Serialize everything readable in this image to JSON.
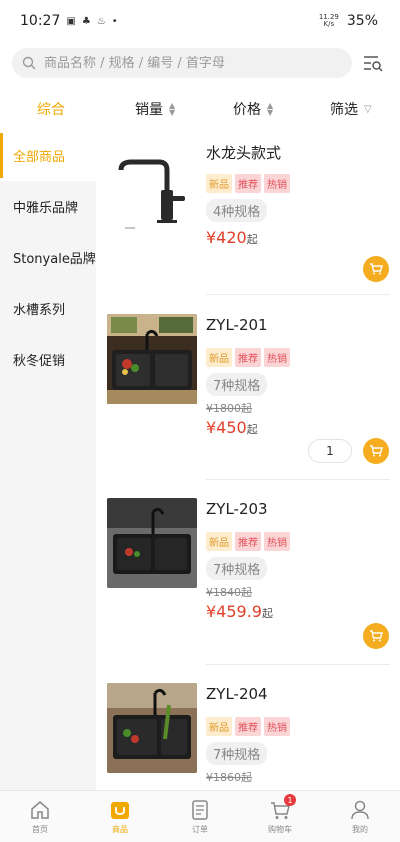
{
  "status_bar": {
    "time": "10:27",
    "net_speed_value": "11.29",
    "net_speed_unit": "K/s",
    "battery": "35%"
  },
  "search": {
    "placeholder": "商品名称 / 规格 / 编号 / 首字母"
  },
  "sort": {
    "comprehensive": "综合",
    "sales": "销量",
    "price": "价格",
    "filter": "筛选"
  },
  "categories": [
    {
      "label": "全部商品",
      "active": true
    },
    {
      "label": "中雅乐品牌",
      "active": false
    },
    {
      "label": "Stonyale品牌",
      "active": false
    },
    {
      "label": "水槽系列",
      "active": false
    },
    {
      "label": "秋冬促销",
      "active": false
    }
  ],
  "tags": {
    "new": "新品",
    "recommend": "推荐",
    "hot": "热销"
  },
  "products": [
    {
      "name": "水龙头款式",
      "spec": "4种规格",
      "old_price": "",
      "price": "¥420",
      "price_suffix": "起",
      "qty": ""
    },
    {
      "name": "ZYL-201",
      "spec": "7种规格",
      "old_price": "¥1800起",
      "price": "¥450",
      "price_suffix": "起",
      "qty": "1"
    },
    {
      "name": "ZYL-203",
      "spec": "7种规格",
      "old_price": "¥1840起",
      "price": "¥459.9",
      "price_suffix": "起",
      "qty": ""
    },
    {
      "name": "ZYL-204",
      "spec": "7种规格",
      "old_price": "¥1860起",
      "price": "",
      "price_suffix": "",
      "qty": ""
    }
  ],
  "tab_bar": {
    "home": "首页",
    "goods": "商品",
    "orders": "订单",
    "cart": "购物车",
    "cart_badge": "1",
    "mine": "我的"
  },
  "colors": {
    "accent": "#f0a800",
    "price": "#e0402b",
    "cart_button": "#f5ad1f"
  }
}
